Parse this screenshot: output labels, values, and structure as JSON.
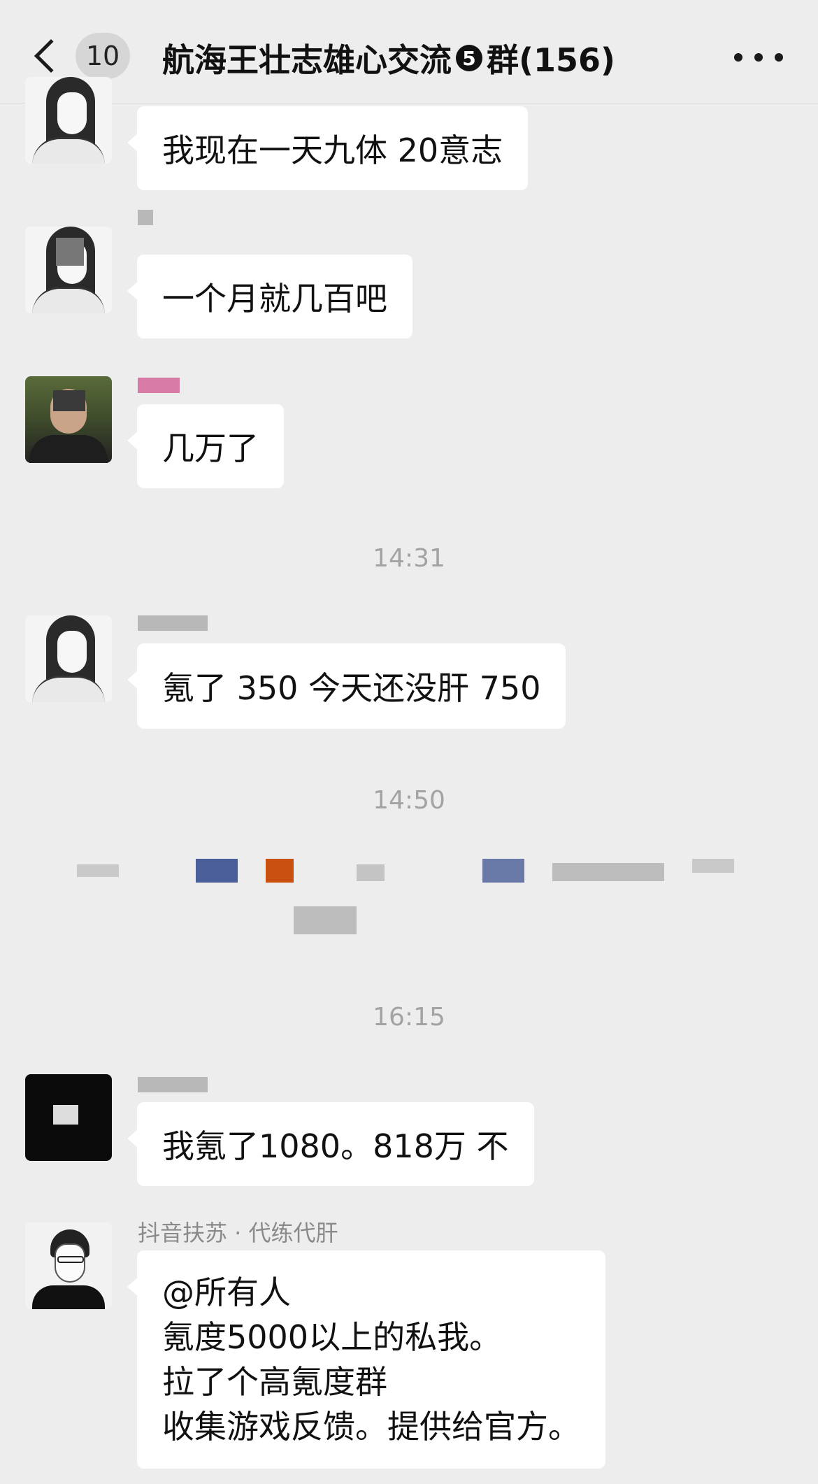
{
  "header": {
    "unread_count": "10",
    "title_prefix": "航海王壮志雄心交流",
    "title_badge": "5",
    "title_suffix": "群(156)"
  },
  "messages": [
    {
      "text": "我现在一天九体 20意志"
    },
    {
      "text": "一个月就几百吧"
    },
    {
      "text": "几万了"
    },
    {
      "text": "氪了 350 今天还没肝 750"
    },
    {
      "text": "我氪了1080。818万 不"
    },
    {
      "sender": "抖音扶苏 · 代练代肝",
      "lines": [
        "@所有人",
        "氪度5000以上的私我。",
        "拉了个高氪度群",
        "收集游戏反馈。提供给官方。"
      ]
    }
  ],
  "timestamps": [
    "14:31",
    "14:50",
    "16:15"
  ],
  "colors": {
    "background": "#ededed",
    "bubble": "#ffffff",
    "timestamp": "#a3a3a3"
  }
}
